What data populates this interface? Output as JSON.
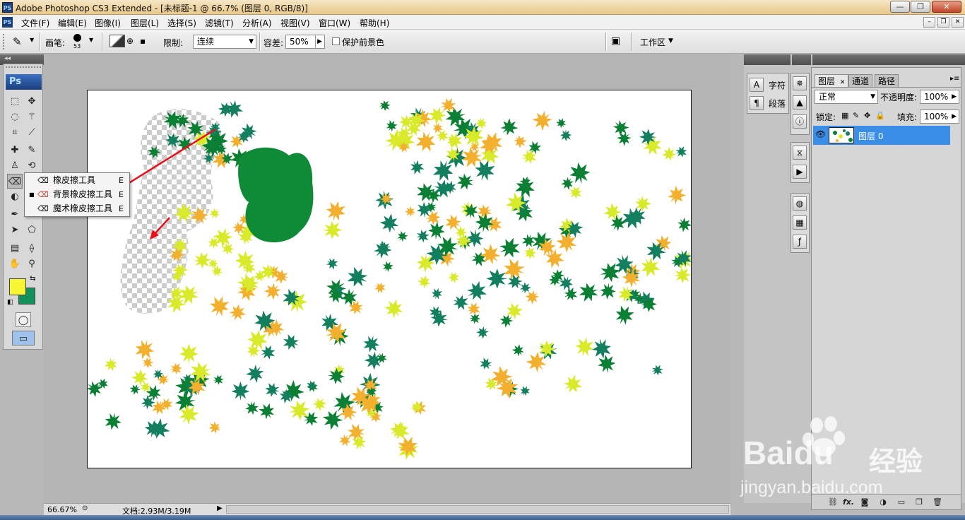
{
  "window": {
    "app_icon": "PS",
    "title": "Adobe Photoshop CS3 Extended - [未标题-1 @ 66.7% (图层 0, RGB/8)]",
    "minimize": "—",
    "maximize": "❐",
    "close": "✕"
  },
  "menu": {
    "items": [
      "文件(F)",
      "编辑(E)",
      "图像(I)",
      "图层(L)",
      "选择(S)",
      "滤镜(T)",
      "分析(A)",
      "视图(V)",
      "窗口(W)",
      "帮助(H)"
    ],
    "doc_minimize": "–",
    "doc_restore": "❐",
    "doc_close": "✕"
  },
  "options": {
    "brush_label": "画笔:",
    "brush_size": "53",
    "limit_label": "限制:",
    "limit_value": "连续",
    "tolerance_label": "容差:",
    "tolerance_value": "50%",
    "protect_fg_label": "保护前景色",
    "protect_fg_checked": false,
    "workspace_label": "工作区"
  },
  "toolbox": {
    "logo": "Ps",
    "foreground_color": "#f7f534",
    "background_color": "#13915a"
  },
  "flyout": {
    "items": [
      {
        "label": "橡皮擦工具",
        "shortcut": "E",
        "selected": false
      },
      {
        "label": "背景橡皮擦工具",
        "shortcut": "E",
        "selected": true
      },
      {
        "label": "魔术橡皮擦工具",
        "shortcut": "E",
        "selected": false
      }
    ]
  },
  "char_panel": {
    "character_label": "字符",
    "paragraph_label": "段落"
  },
  "layers_panel": {
    "tabs": [
      "图层",
      "通道",
      "路径"
    ],
    "tab_close": "✕",
    "blend_mode": "正常",
    "opacity_label": "不透明度:",
    "opacity_value": "100%",
    "lock_label": "锁定:",
    "fill_label": "填充:",
    "fill_value": "100%",
    "layer_name": "图层 0",
    "bottom_fx": "fx."
  },
  "status": {
    "zoom": "66.67%",
    "doc_info": "文档:2.93M/3.19M"
  },
  "watermark": {
    "brand": "Baidu",
    "brand_cn": "经验",
    "url": "jingyan.baidu.com"
  },
  "colors": {
    "leaf_dark": "#0b7f33",
    "leaf_teal": "#137f5f",
    "leaf_yellow": "#d9ea2a",
    "leaf_orange": "#f3b02e",
    "arrow_red": "#e8101a",
    "blob_green": "#0f8a37",
    "selection_blue": "#3b8ee8"
  }
}
